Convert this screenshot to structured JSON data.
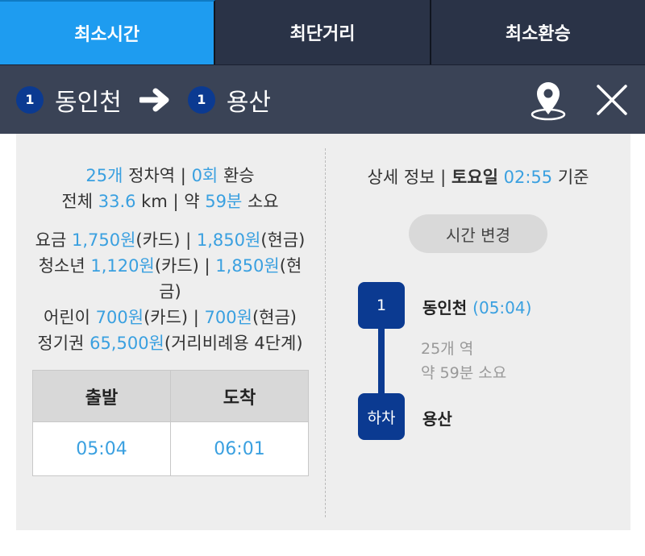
{
  "tabs": [
    {
      "label": "최소시간",
      "active": true
    },
    {
      "label": "최단거리",
      "active": false
    },
    {
      "label": "최소환승",
      "active": false
    }
  ],
  "route": {
    "from": {
      "line": "1",
      "name": "동인천"
    },
    "to": {
      "line": "1",
      "name": "용산"
    }
  },
  "summary": {
    "stops_count": "25개",
    "stops_label": "정차역 |",
    "transfer_count": "0회",
    "transfer_label": "환승",
    "total_label": "전체",
    "distance": "33.6",
    "distance_unit": "km | 약",
    "duration": "59분",
    "duration_label": "소요"
  },
  "fares": {
    "general_label": "요금",
    "general_card": "1,750원",
    "card_label": "(카드) |",
    "general_cash": "1,850원",
    "cash_label": "(현금)",
    "youth_label": "청소년",
    "youth_card": "1,120원",
    "youth_card_label": "(카드) |",
    "youth_cash": "1,850원",
    "youth_cash_label_a": "(현",
    "youth_cash_label_b": "금)",
    "child_label": "어린이",
    "child_card": "700원",
    "child_card_label": "(카드) |",
    "child_cash": "700원",
    "child_cash_label": "(현금)",
    "pass_label": "정기권",
    "pass_value": "65,500원",
    "pass_note": "(거리비례용 4단계)"
  },
  "times": {
    "depart_label": "출발",
    "arrive_label": "도착",
    "depart": "05:04",
    "arrive": "06:01"
  },
  "detail": {
    "label": "상세 정보 |",
    "day": "토요일",
    "time": "02:55",
    "basis": "기준",
    "change_button": "시간 변경"
  },
  "timeline": {
    "start_badge": "1",
    "start_station": "동인천",
    "start_time": "(05:04)",
    "stops": "25개 역",
    "duration": "약 59분 소요",
    "end_badge": "하차",
    "end_station": "용산"
  },
  "colors": {
    "active_tab": "#1e9cf0",
    "header_bg": "#2a3347",
    "route_bar": "#3a4356",
    "line1": "#0b3a91",
    "highlight": "#3aa0e0"
  },
  "icons": [
    "arrow-right-icon",
    "location-pin-icon",
    "close-icon"
  ]
}
